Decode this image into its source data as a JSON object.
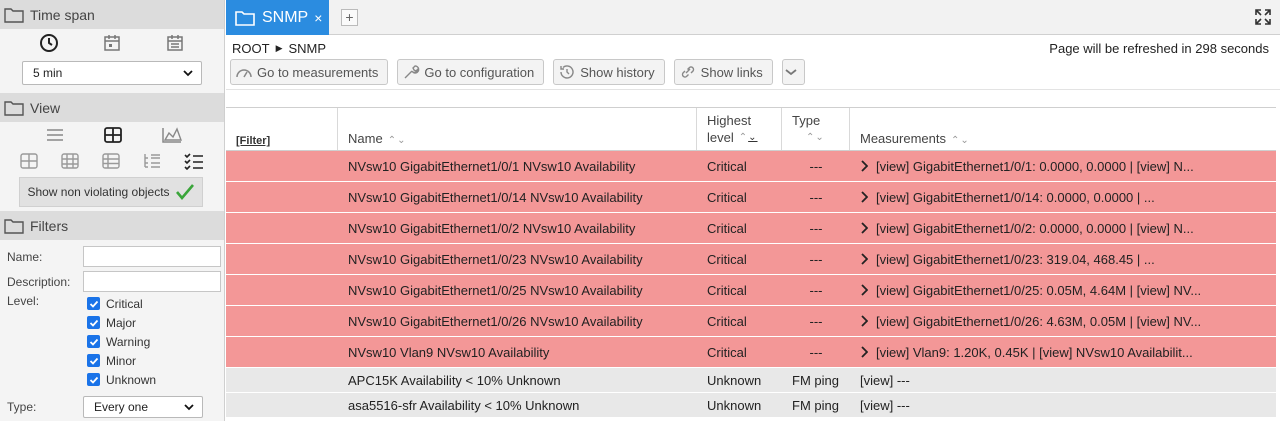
{
  "left": {
    "time_span": {
      "title": "Time span",
      "select_value": "5 min"
    },
    "view": {
      "title": "View",
      "non_violating_label": "Show non violating objects"
    },
    "filters": {
      "title": "Filters",
      "name_label": "Name:",
      "description_label": "Description:",
      "level_label": "Level:",
      "levels": [
        "Critical",
        "Major",
        "Warning",
        "Minor",
        "Unknown"
      ],
      "type_label": "Type:",
      "type_value": "Every one"
    }
  },
  "tab": {
    "label": "SNMP",
    "close": "×",
    "add": "+"
  },
  "breadcrumb": {
    "root": "ROOT",
    "current": "SNMP"
  },
  "refresh_text": "Page will be refreshed in 298 seconds",
  "toolbar": {
    "measurements": "Go to measurements",
    "configuration": "Go to configuration",
    "history": "Show history",
    "links": "Show links"
  },
  "table": {
    "headers": {
      "filter": "[Filter]",
      "name": "Name",
      "highest_1": "Highest",
      "highest_2": "level",
      "type": "Type",
      "measurements": "Measurements"
    },
    "rows": [
      {
        "name": "NVsw10 GigabitEthernet1/0/1 NVsw10 Availability",
        "level": "Critical",
        "type": "---",
        "measurements": "[view] GigabitEthernet1/0/1: 0.0000, 0.0000 | [view] N..."
      },
      {
        "name": "NVsw10 GigabitEthernet1/0/14 NVsw10 Availability",
        "level": "Critical",
        "type": "---",
        "measurements": "[view] GigabitEthernet1/0/14: 0.0000, 0.0000 | ..."
      },
      {
        "name": "NVsw10 GigabitEthernet1/0/2 NVsw10 Availability",
        "level": "Critical",
        "type": "---",
        "measurements": "[view] GigabitEthernet1/0/2: 0.0000, 0.0000 | [view] N..."
      },
      {
        "name": "NVsw10 GigabitEthernet1/0/23 NVsw10 Availability",
        "level": "Critical",
        "type": "---",
        "measurements": "[view] GigabitEthernet1/0/23: 319.04, 468.45 | ..."
      },
      {
        "name": "NVsw10 GigabitEthernet1/0/25 NVsw10 Availability",
        "level": "Critical",
        "type": "---",
        "measurements": "[view] GigabitEthernet1/0/25: 0.05M, 4.64M | [view] NV..."
      },
      {
        "name": "NVsw10 GigabitEthernet1/0/26 NVsw10 Availability",
        "level": "Critical",
        "type": "---",
        "measurements": "[view] GigabitEthernet1/0/26: 4.63M, 0.05M | [view] NV..."
      },
      {
        "name": "NVsw10 Vlan9 NVsw10 Availability",
        "level": "Critical",
        "type": "---",
        "measurements": "[view] Vlan9: 1.20K, 0.45K | [view] NVsw10 Availabilit..."
      },
      {
        "name": "APC15K Availability < 10% Unknown",
        "level": "Unknown",
        "type": "FM ping",
        "measurements": "[view] ---"
      },
      {
        "name": "asa5516-sfr Availability < 10% Unknown",
        "level": "Unknown",
        "type": "FM ping",
        "measurements": "[view] ---"
      }
    ]
  },
  "colors": {
    "critical_row": "#f39797",
    "unknown_row": "#e8e8e8",
    "tab_blue": "#2b8ce0",
    "check_green": "#3aa53a"
  }
}
